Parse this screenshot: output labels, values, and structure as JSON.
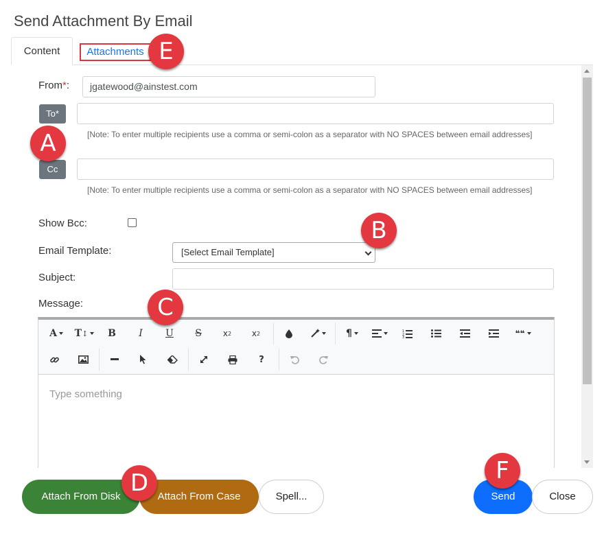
{
  "dialog": {
    "title": "Send Attachment By Email"
  },
  "tabs": [
    {
      "label": "Content"
    },
    {
      "label": "Attachments"
    }
  ],
  "badges": {
    "a": "A",
    "b": "B",
    "c": "C",
    "d": "D",
    "e": "E",
    "f": "F"
  },
  "badge_color": "#e3383f",
  "form": {
    "from_label": "From",
    "required_mark": "*",
    "from_suffix": ":",
    "from_value": "jgatewood@ainstest.com",
    "to_button": "To*",
    "cc_button": "Cc",
    "note": "[Note: To enter multiple recipients use a comma or semi-colon as a separator with NO SPACES between email addresses]",
    "show_bcc_label": "Show Bcc:",
    "template_label": "Email Template:",
    "template_selected": "[Select Email Template]",
    "subject_label": "Subject:",
    "message_label": "Message:"
  },
  "editor": {
    "placeholder": "Type something",
    "toolbar_row1": [
      "font-icon",
      "text-height-icon",
      "bold-icon",
      "italic-icon",
      "underline-icon",
      "strikethrough-icon",
      "subscript-icon",
      "superscript-icon",
      "color-icon",
      "magic-icon",
      "paragraph-icon",
      "align-icon",
      "ordered-list-icon",
      "unordered-list-icon",
      "outdent-icon",
      "indent-icon",
      "quote-icon"
    ],
    "toolbar_row2": [
      "link-icon",
      "image-icon",
      "horizontal-rule-icon",
      "cursor-icon",
      "eraser-icon",
      "fullscreen-icon",
      "print-icon",
      "help-icon",
      "undo-icon",
      "redo-icon"
    ],
    "glyphs": {
      "bold": "B",
      "italic": "I",
      "underline": "U",
      "strike": "S",
      "sub": "x",
      "sub_mark": "2",
      "sup": "x",
      "sup_mark": "2",
      "font": "A",
      "height": "T",
      "help": "?",
      "paragraph": "¶",
      "quote": "❝❝"
    }
  },
  "buttons": {
    "attach_disk": "Attach From Disk",
    "attach_case": "Attach From Case",
    "spell": "Spell...",
    "send": "Send",
    "close": "Close"
  },
  "colors": {
    "attach_disk": "#3a8337",
    "attach_case": "#b06a12",
    "send": "#0d6efd",
    "link": "#1a73e8"
  }
}
